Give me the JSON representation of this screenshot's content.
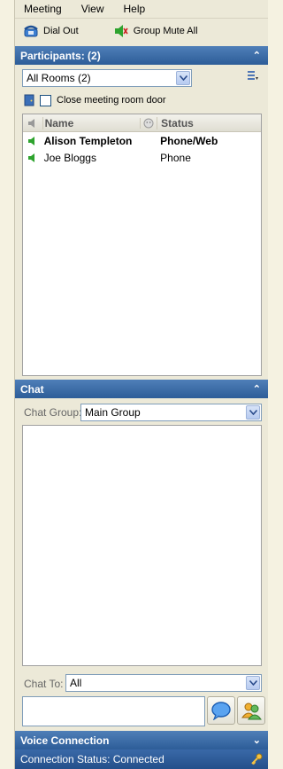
{
  "menu": {
    "items": [
      "Meeting",
      "View",
      "Help"
    ]
  },
  "toolbar": {
    "dial_out": "Dial Out",
    "group_mute": "Group Mute All"
  },
  "participants": {
    "header": "Participants: (2)",
    "room_select": "All Rooms  (2)",
    "close_door_label": "Close meeting room door",
    "columns": {
      "name": "Name",
      "status": "Status"
    },
    "rows": [
      {
        "name": "Alison Templeton",
        "status": "Phone/Web"
      },
      {
        "name": "Joe Bloggs",
        "status": "Phone"
      }
    ]
  },
  "chat": {
    "header": "Chat",
    "group_label": "Chat Group:",
    "group_value": "Main Group",
    "to_label": "Chat To:",
    "to_value": "All"
  },
  "voice": {
    "header": "Voice Connection",
    "status": "Connection Status: Connected"
  },
  "colors": {
    "header_blue": "#2d5d98",
    "speaker_green": "#2ea32e"
  }
}
